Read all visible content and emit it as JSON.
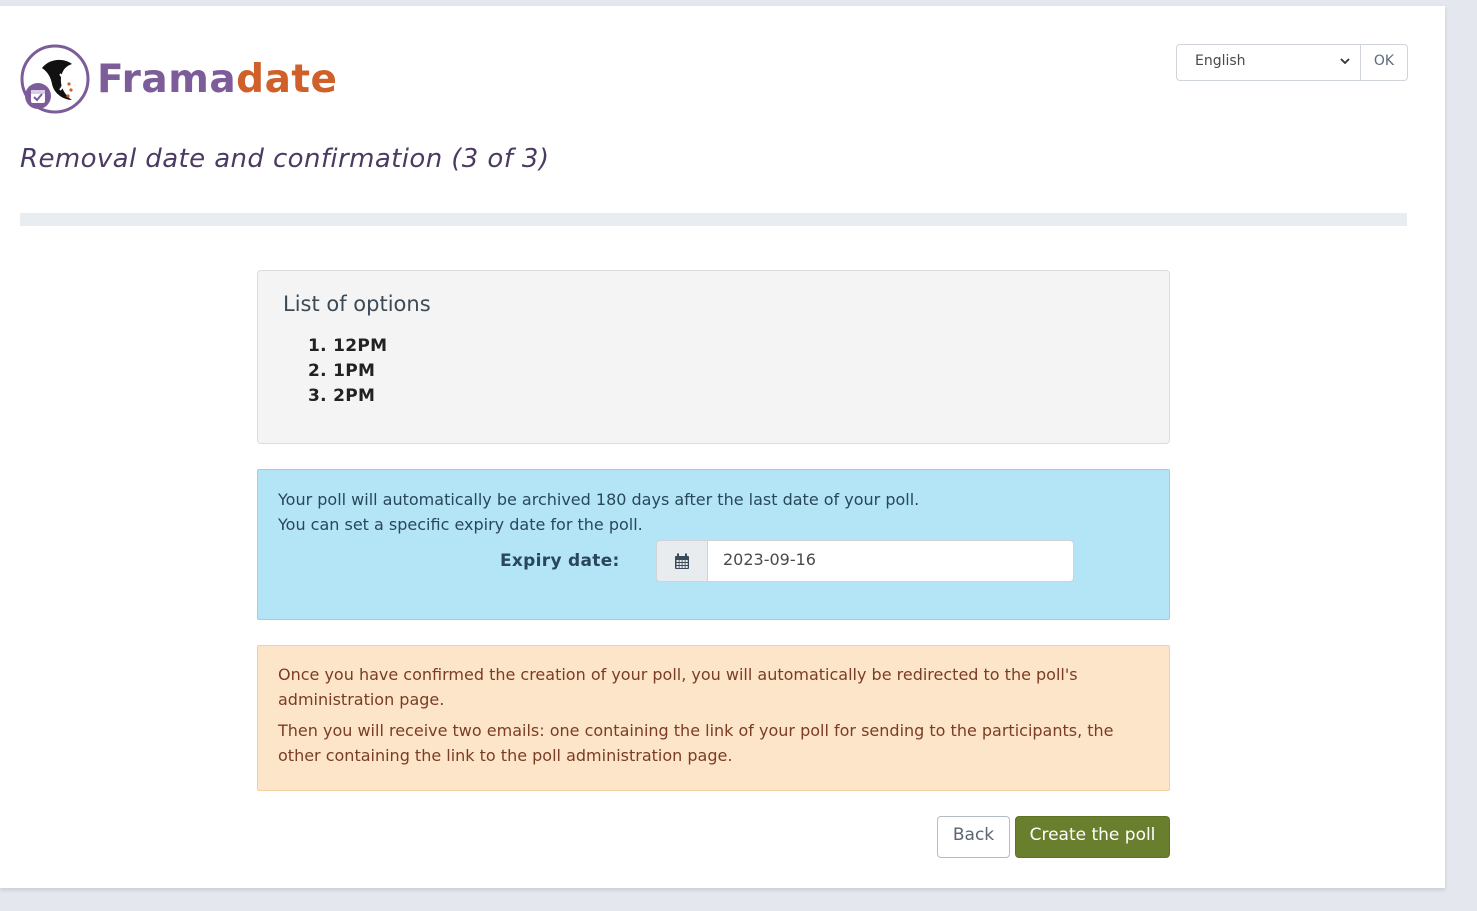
{
  "header": {
    "logo_part1": "Frama",
    "logo_part2": "date",
    "language": {
      "selected": "English",
      "ok_label": "OK"
    }
  },
  "page_title": "Removal date and confirmation (3 of 3)",
  "options_panel": {
    "title": "List of options",
    "items": [
      "1. 12PM",
      "2. 1PM",
      "3. 2PM"
    ]
  },
  "info_panel": {
    "line1": "Your poll will automatically be archived 180 days after the last date of your poll.",
    "line2": "You can set a specific expiry date for the poll.",
    "expiry_label": "Expiry date:",
    "expiry_value": "2023-09-16",
    "calendar_icon": "calendar-icon"
  },
  "warning_panel": {
    "para1": "Once you have confirmed the creation of your poll, you will automatically be redirected to the poll's administration page.",
    "para2": "Then you will receive two emails: one containing the link of your poll for sending to the participants, the other containing the link to the poll administration page."
  },
  "actions": {
    "back_label": "Back",
    "create_label": "Create the poll"
  },
  "colors": {
    "brand_purple": "#7c5d9a",
    "brand_orange": "#d0602a",
    "info_bg": "#b3e5f7",
    "warning_bg": "#fde5c9",
    "primary_button": "#6a7f2d"
  }
}
